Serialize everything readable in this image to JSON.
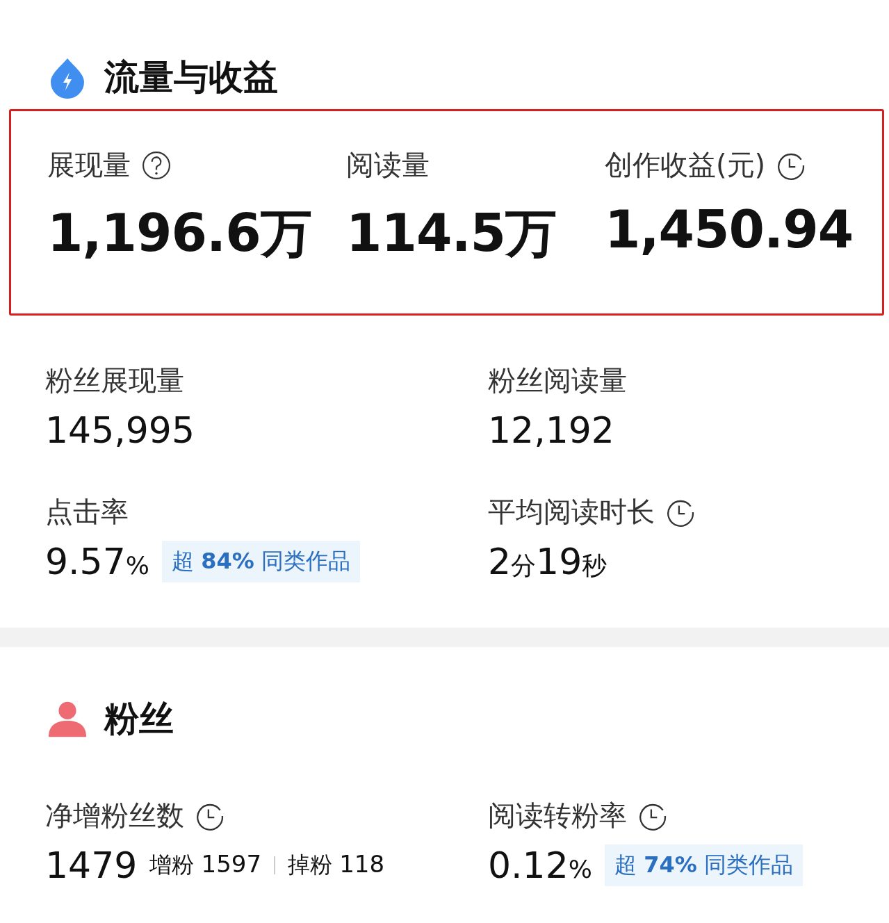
{
  "sections": [
    {
      "title": "流量与收益",
      "highlight": [
        {
          "label": "展现量",
          "kind": "help",
          "value": "1,196.6万"
        },
        {
          "label": "阅读量",
          "kind": "plain",
          "value": "114.5万"
        },
        {
          "label": "创作收益(元)",
          "kind": "clock",
          "value": "1,450.94"
        }
      ],
      "metrics": [
        {
          "label": "粉丝展现量",
          "kind": "plain",
          "value_parts": [
            {
              "kind": "num",
              "text": "145,995"
            }
          ]
        },
        {
          "label": "粉丝阅读量",
          "kind": "plain",
          "value_parts": [
            {
              "kind": "num",
              "text": "12,192"
            }
          ]
        },
        {
          "label": "点击率",
          "kind": "plain",
          "value_parts": [
            {
              "kind": "num",
              "text": "9.57"
            },
            {
              "kind": "unit",
              "text": "%"
            }
          ],
          "badge": "超 **84%** 同类作品"
        },
        {
          "label": "平均阅读时长",
          "kind": "clock",
          "value_parts": [
            {
              "kind": "num",
              "text": "2"
            },
            {
              "kind": "unit",
              "text": "分"
            },
            {
              "kind": "num",
              "text": "19"
            },
            {
              "kind": "unit",
              "text": "秒"
            }
          ]
        }
      ]
    },
    {
      "title": "粉丝",
      "metrics": [
        {
          "label": "净增粉丝数",
          "kind": "clock",
          "value_parts": [
            {
              "kind": "num",
              "text": "1479"
            }
          ],
          "extras": [
            {
              "label": "增粉",
              "value": "1597"
            },
            {
              "label": "掉粉",
              "value": "118"
            }
          ]
        },
        {
          "label": "阅读转粉率",
          "kind": "clock",
          "value_parts": [
            {
              "kind": "num",
              "text": "0.12"
            },
            {
              "kind": "unit",
              "text": "%"
            }
          ],
          "badge": "超 **74%** 同类作品"
        }
      ]
    }
  ]
}
